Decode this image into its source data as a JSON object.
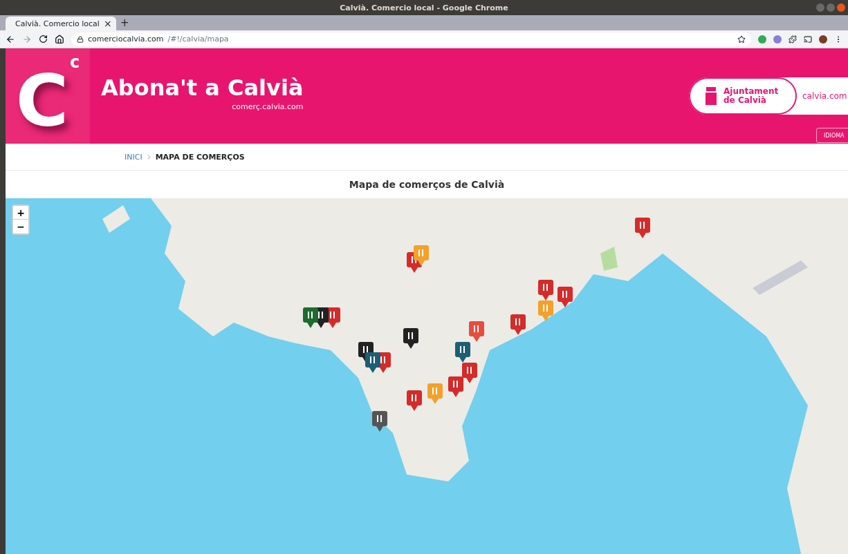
{
  "window": {
    "title": "Calvià. Comercio local - Google Chrome"
  },
  "tabs": [
    {
      "label": "Calvià. Comercio local",
      "selected": true,
      "close": "×"
    }
  ],
  "new_tab": "+",
  "address_bar": {
    "domain": "comerciocalvia.com",
    "path": "/#!/calvia/mapa"
  },
  "header": {
    "logo_letter": "C",
    "logo_superscript": "c",
    "title": "Abona't a Calvià",
    "subtitle": "comerç.calvia.com",
    "council": {
      "line1": "Ajuntament",
      "line2": "de Calvià",
      "link": "calvia.com"
    },
    "language_button": "IDIOMA"
  },
  "breadcrumb": [
    {
      "label": "INICI",
      "kind": "link"
    },
    {
      "label": "MAPA DE COMERÇOS",
      "kind": "current"
    }
  ],
  "page_title": "Mapa de comerços de Calvià",
  "map": {
    "zoom_in": "+",
    "zoom_out": "−"
  }
}
